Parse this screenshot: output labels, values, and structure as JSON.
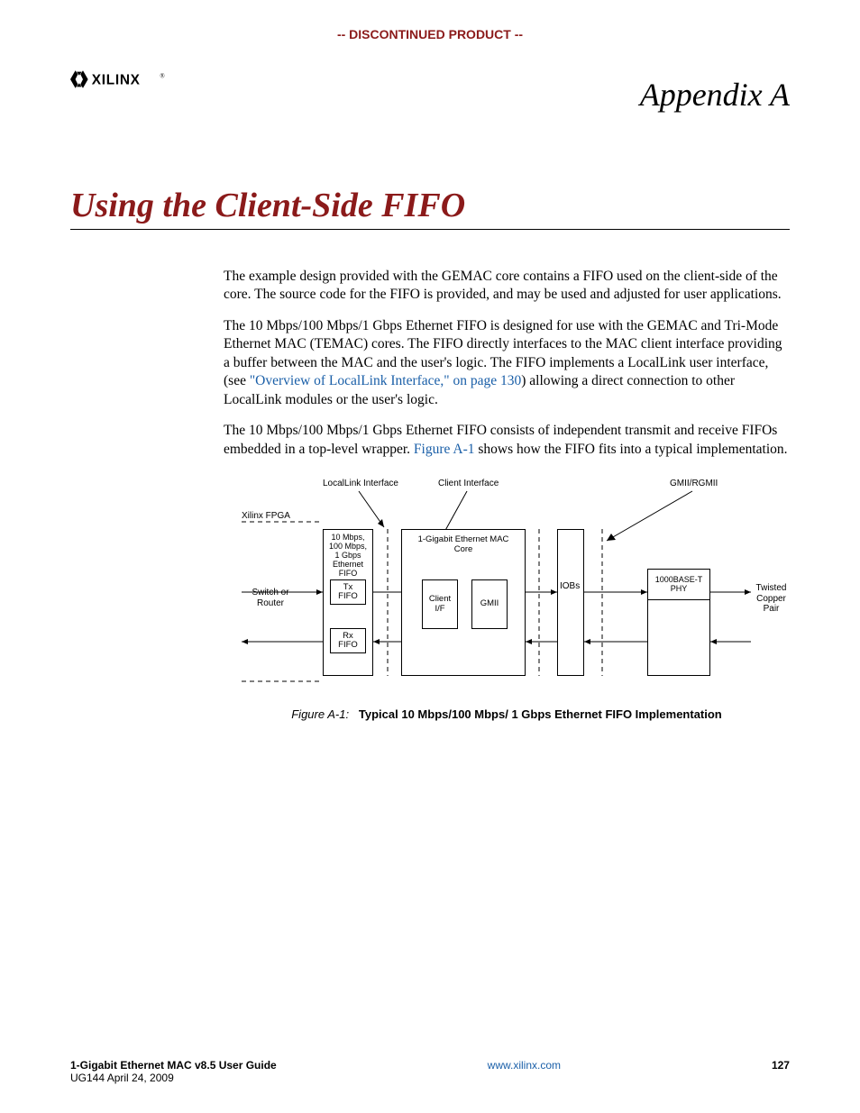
{
  "banner": "-- DISCONTINUED PRODUCT --",
  "brand": "XILINX",
  "appendix_label": "Appendix A",
  "title": "Using the Client-Side FIFO",
  "para1": "The example design provided with the GEMAC core contains a FIFO used on the client-side of the core. The source code for the FIFO is provided, and may be used and adjusted for user applications.",
  "para2_a": "The 10 Mbps/100 Mbps/1 Gbps Ethernet FIFO is designed for use with the GEMAC and Tri-Mode Ethernet MAC (TEMAC) cores. The FIFO directly interfaces to the MAC client interface providing a buffer between the MAC and the user's logic. The FIFO implements a LocalLink user interface, (see ",
  "para2_link": "\"Overview of LocalLink Interface,\" on page 130",
  "para2_b": ") allowing a direct connection to other LocalLink modules or the user's logic.",
  "para3_a": "The 10 Mbps/100 Mbps/1 Gbps Ethernet FIFO consists of independent transmit and receive FIFOs embedded in a top-level wrapper. ",
  "para3_link": "Figure A-1",
  "para3_b": " shows how the FIFO fits into a typical implementation.",
  "figure": {
    "num": "Figure A-1:",
    "caption": "Typical 10 Mbps/100 Mbps/ 1 Gbps Ethernet FIFO Implementation",
    "labels": {
      "locallink": "LocalLink Interface",
      "client_if": "Client Interface",
      "gmii_rgmii": "GMII/RGMII",
      "fpga": "Xilinx FPGA",
      "fifo_title": "10 Mbps,\n100 Mbps,\n1 Gbps\nEthernet FIFO",
      "mac_core": "1-Gigabit Ethernet MAC\nCore",
      "switch": "Switch or\nRouter",
      "tx": "Tx\nFIFO",
      "rx": "Rx\nFIFO",
      "clientif": "Client\nI/F",
      "gmii": "GMII",
      "iobs": "IOBs",
      "phy": "1000BASE-T\nPHY",
      "twisted": "Twisted\nCopper\nPair"
    }
  },
  "footer": {
    "left_bold": "1-Gigabit Ethernet MAC v8.5 User Guide",
    "left_line2": "UG144 April 24, 2009",
    "center": "www.xilinx.com",
    "right": "127"
  }
}
